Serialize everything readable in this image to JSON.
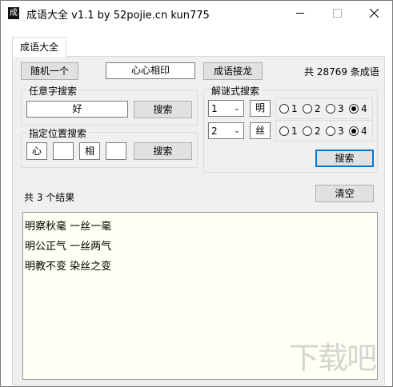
{
  "window": {
    "title": "成语大全 v1.1 by 52pojie.cn kun775",
    "icon_label": "成",
    "icons": {
      "app": "app-icon",
      "minimize": "minimize-icon",
      "maximize": "maximize-icon",
      "close": "close-icon"
    }
  },
  "tabs": [
    {
      "label": "成语大全"
    }
  ],
  "top": {
    "random_button": "随机一个",
    "current_idiom": "心心相印",
    "chain_button": "成语接龙",
    "count_text": "共 28769 条成语"
  },
  "any_char_search": {
    "title": "任意字搜索",
    "input_value": "好",
    "search_button": "搜索"
  },
  "position_search": {
    "title": "指定位置搜索",
    "slots": [
      "心",
      "",
      "相",
      ""
    ],
    "search_button": "搜索"
  },
  "riddle_search": {
    "title": "解谜式搜索",
    "rows": [
      {
        "select_value": "1",
        "char": "明",
        "options": [
          "1",
          "2",
          "3",
          "4"
        ],
        "selected": "4"
      },
      {
        "select_value": "2",
        "char": "丝",
        "options": [
          "1",
          "2",
          "3",
          "4"
        ],
        "selected": "4"
      }
    ],
    "search_button": "搜索"
  },
  "results": {
    "summary": "共 3 个结果",
    "clear_button": "清空",
    "lines": [
      "明察秋毫 一丝一毫",
      "明公正气 一丝两气",
      "明教不变 染丝之变"
    ]
  },
  "watermark": "下载吧"
}
